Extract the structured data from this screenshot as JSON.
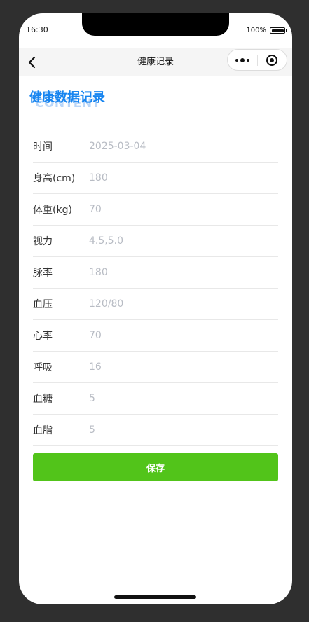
{
  "status": {
    "time": "16:30",
    "battery": "100%"
  },
  "navbar": {
    "title": "健康记录"
  },
  "page": {
    "heading": "健康数据记录",
    "heading_bg": "CONTENT"
  },
  "form": {
    "rows": [
      {
        "label": "时间",
        "value": "2025-03-04"
      },
      {
        "label": "身高(cm)",
        "value": "180"
      },
      {
        "label": "体重(kg)",
        "value": "70"
      },
      {
        "label": "视力",
        "value": "4.5,5.0"
      },
      {
        "label": "脉率",
        "value": "180"
      },
      {
        "label": "血压",
        "value": "120/80"
      },
      {
        "label": "心率",
        "value": "70"
      },
      {
        "label": "呼吸",
        "value": "16"
      },
      {
        "label": "血糖",
        "value": "5"
      },
      {
        "label": "血脂",
        "value": "5"
      }
    ]
  },
  "actions": {
    "save_label": "保存"
  },
  "colors": {
    "accent": "#1785f0",
    "save_button": "#52c41a"
  }
}
